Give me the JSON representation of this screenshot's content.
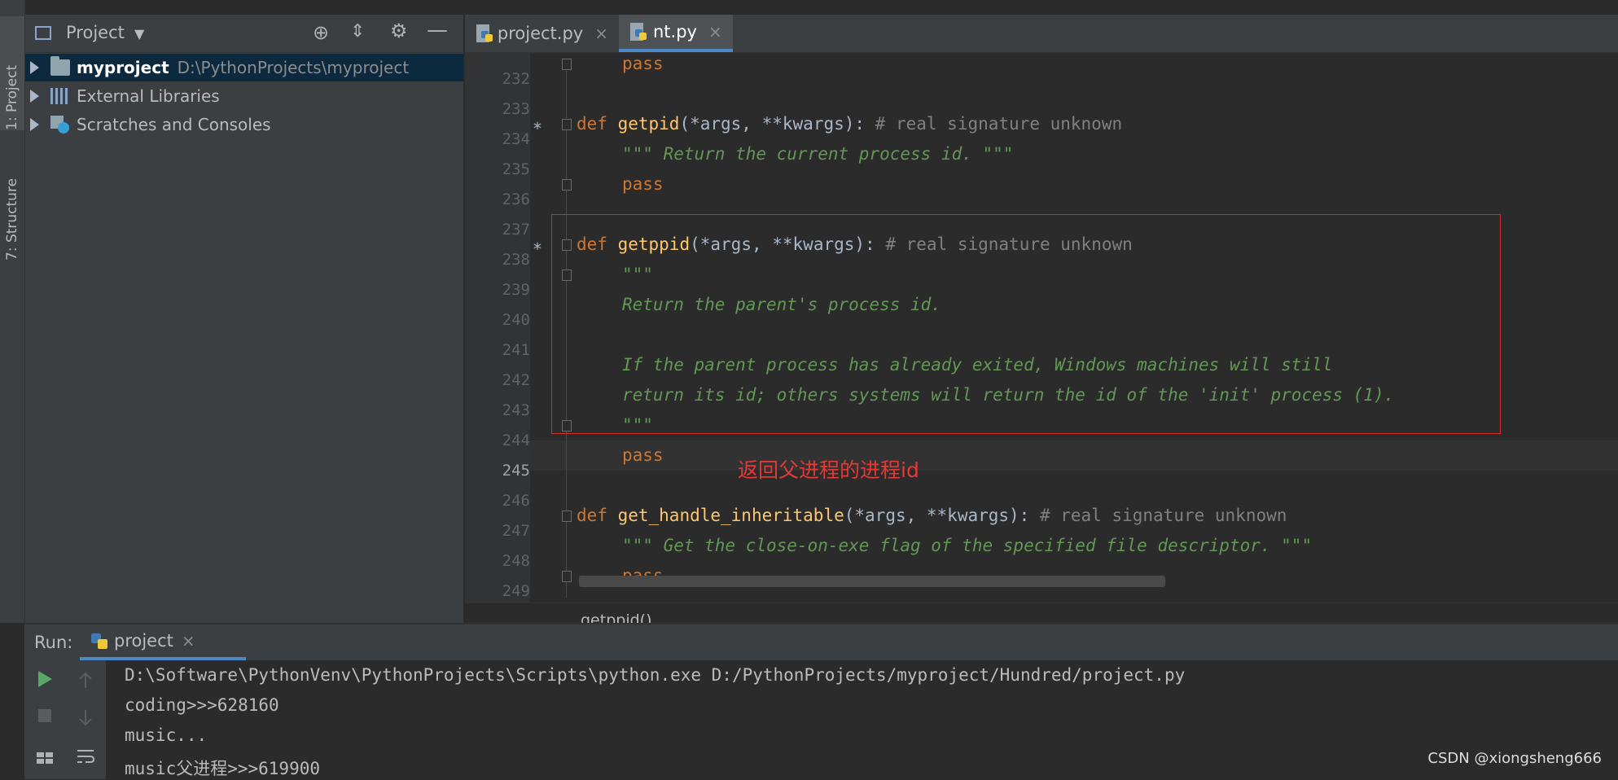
{
  "left_strip": {
    "project_tab": "1: Project",
    "structure_tab": "7: Structure"
  },
  "project_panel": {
    "title": "Project",
    "tree": [
      {
        "name": "myproject",
        "path": "D:\\PythonProjects\\myproject"
      },
      {
        "name": "External Libraries"
      },
      {
        "name": "Scratches and Consoles"
      }
    ]
  },
  "editor": {
    "tabs": [
      {
        "label": "project.py",
        "close": "×"
      },
      {
        "label": "nt.py",
        "close": "×"
      }
    ],
    "line_numbers": [
      "232",
      "233",
      "234",
      "235",
      "236",
      "237",
      "238",
      "239",
      "240",
      "241",
      "242",
      "243",
      "244",
      "245",
      "246",
      "247",
      "248",
      "249"
    ],
    "code": {
      "l232": "pass",
      "l234_def": "def",
      "l234_fn": "getpid",
      "l234_args": "(*args, **kwargs): ",
      "l234_comment": "# real signature unknown",
      "l235": "\"\"\" Return the current process id. \"\"\"",
      "l236": "pass",
      "l238_def": "def",
      "l238_fn": "getppid",
      "l238_args": "(*args, **kwargs): ",
      "l238_comment": "# real signature unknown",
      "l239": "\"\"\"",
      "l240": "Return the parent's process id.",
      "l242": "If the parent process has already exited, Windows machines will still",
      "l243": "return its id; others systems will return the id of the 'init' process (1).",
      "l244": "\"\"\"",
      "l245": "pass",
      "l247_def": "def",
      "l247_fn": "get_handle_inheritable",
      "l247_args": "(*args, **kwargs): ",
      "l247_comment": "# real signature unknown",
      "l248": "\"\"\" Get the close-on-exe flag of the specified file descriptor. \"\"\"",
      "l249": "pass"
    },
    "annotation": "返回父进程的进程id",
    "breadcrumb": "getppid()"
  },
  "run_panel": {
    "label": "Run:",
    "tab": "project",
    "tab_close": "×",
    "output": [
      "D:\\Software\\PythonVenv\\PythonProjects\\Scripts\\python.exe D:/PythonProjects/myproject/Hundred/project.py",
      "coding>>>628160",
      "music...",
      "music父进程>>>619900"
    ]
  },
  "watermark": "CSDN @xiongsheng666",
  "colors": {
    "keyword": "#cc7832",
    "function": "#ffc66d",
    "docstring": "#629755",
    "comment": "#808080",
    "highlight_box": "#d32f2f"
  }
}
